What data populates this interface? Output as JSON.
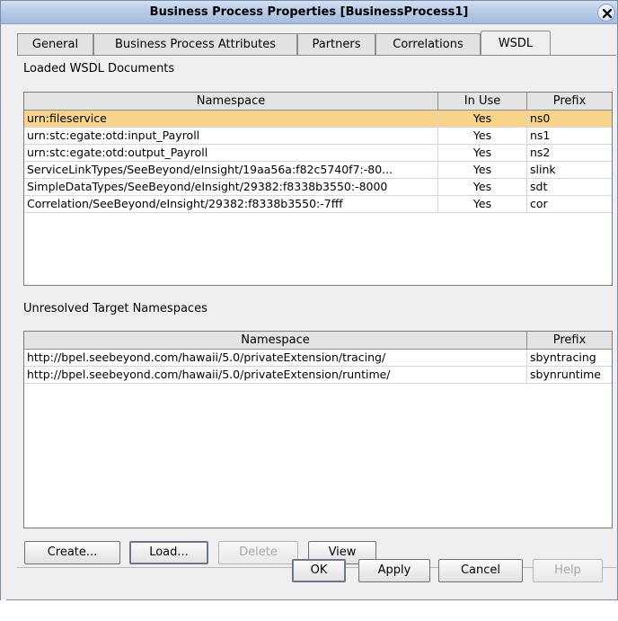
{
  "window": {
    "title": "Business Process Properties [BusinessProcess1]"
  },
  "tabs": [
    {
      "label": "General"
    },
    {
      "label": "Business Process Attributes"
    },
    {
      "label": "Partners"
    },
    {
      "label": "Correlations"
    },
    {
      "label": "WSDL"
    }
  ],
  "active_tab": "WSDL",
  "loaded": {
    "label": "Loaded WSDL Documents",
    "columns": [
      "Namespace",
      "In Use",
      "Prefix"
    ],
    "rows": [
      [
        "urn:fileservice",
        "Yes",
        "ns0"
      ],
      [
        "urn:stc:egate:otd:input_Payroll",
        "Yes",
        "ns1"
      ],
      [
        "urn:stc:egate:otd:output_Payroll",
        "Yes",
        "ns2"
      ],
      [
        "ServiceLinkTypes/SeeBeyond/eInsight/19aa56a:f82c5740f7:-80...",
        "Yes",
        "slink"
      ],
      [
        "SimpleDataTypes/SeeBeyond/eInsight/29382:f8338b3550:-8000",
        "Yes",
        "sdt"
      ],
      [
        "Correlation/SeeBeyond/eInsight/29382:f8338b3550:-7fff",
        "Yes",
        "cor"
      ]
    ],
    "selected_row": 0
  },
  "unresolved": {
    "label": "Unresolved Target Namespaces",
    "columns": [
      "Namespace",
      "Prefix"
    ],
    "rows": [
      [
        "http://bpel.seebeyond.com/hawaii/5.0/privateExtension/tracing/",
        "sbyntracing"
      ],
      [
        "http://bpel.seebeyond.com/hawaii/5.0/privateExtension/runtime/",
        "sbynruntime"
      ]
    ]
  },
  "actions": {
    "create": "Create...",
    "load": "Load...",
    "delete": "Delete",
    "view": "View"
  },
  "footer": {
    "ok": "OK",
    "apply": "Apply",
    "cancel": "Cancel",
    "help": "Help"
  },
  "colors": {
    "selected_row": "#f8d48a",
    "title_bar": "#b6c9e6"
  },
  "icons": {
    "close": "close-icon"
  }
}
